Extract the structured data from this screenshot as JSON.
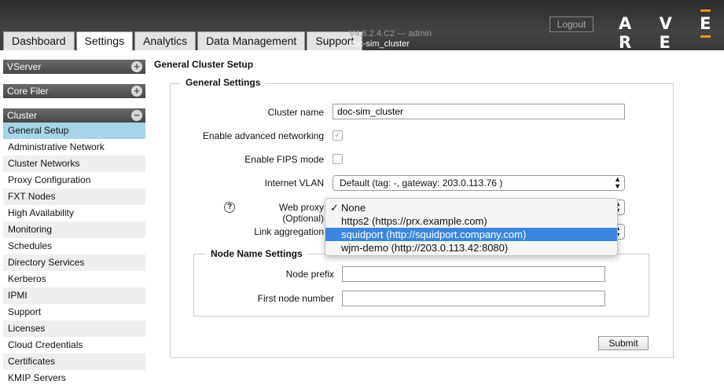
{
  "header": {
    "tabs": [
      "Dashboard",
      "Settings",
      "Analytics",
      "Data Management",
      "Support"
    ],
    "active_tab": "Settings",
    "version": "V4.6.2.4.C2 --- admin",
    "cluster": "doc-sim_cluster",
    "logout": "Logout",
    "logo": "AVERE"
  },
  "sidebar": {
    "sections": [
      {
        "label": "VServer",
        "icon": "plus-circle-icon"
      },
      {
        "label": "Core Filer",
        "icon": "plus-circle-icon"
      },
      {
        "label": "Cluster",
        "icon": "minus-circle-icon"
      }
    ],
    "cluster_items": [
      "General Setup",
      "Administrative Network",
      "Cluster Networks",
      "Proxy Configuration",
      "FXT Nodes",
      "High Availability",
      "Monitoring",
      "Schedules",
      "Directory Services",
      "Kerberos",
      "IPMI",
      "Support",
      "Licenses",
      "Cloud Credentials",
      "Certificates",
      "KMIP Servers"
    ],
    "selected": "General Setup"
  },
  "main": {
    "page_title": "General Cluster Setup",
    "general_legend": "General Settings",
    "cluster_name_label": "Cluster name",
    "cluster_name_value": "doc-sim_cluster",
    "adv_networking_label": "Enable advanced networking",
    "adv_networking_checked": true,
    "fips_label": "Enable FIPS mode",
    "fips_checked": false,
    "vlan_label": "Internet VLAN",
    "vlan_value": "Default (tag: -, gateway: 203.0.113.76 )",
    "help_icon": "?",
    "web_proxy_label": "Web proxy (Optional)",
    "link_agg_label": "Link aggregation",
    "node_legend": "Node Name Settings",
    "node_prefix_label": "Node prefix",
    "node_prefix_value": "",
    "first_node_label": "First node number",
    "first_node_value": "",
    "submit": "Submit"
  },
  "proxy_dropdown": {
    "options": [
      "None",
      "https2 (https://prx.example.com)",
      "squidport (http://squidport.company.com)",
      "wjm-demo (http://203.0.113.42:8080)"
    ],
    "checked": "None",
    "highlighted": "squidport (http://squidport.company.com)",
    "check_glyph": "✓"
  },
  "colors": {
    "selected_nav": "#a9d4e6",
    "highlight": "#3a87e0",
    "logo_accent": "#e8971e"
  }
}
